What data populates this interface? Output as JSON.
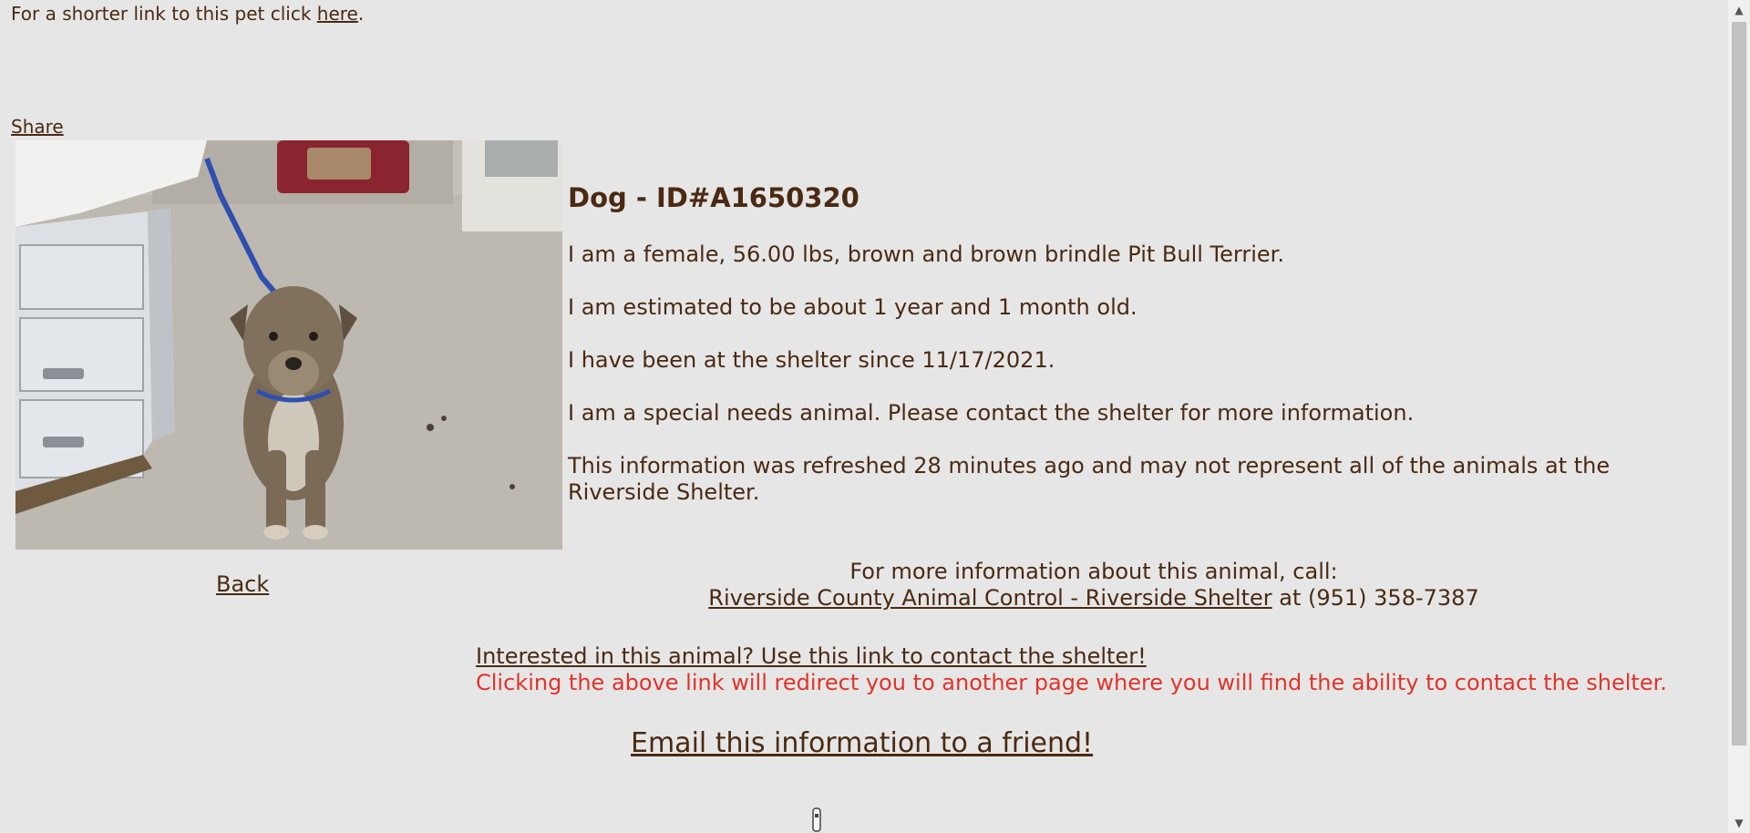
{
  "shortlink": {
    "prefix": "For a shorter link to this pet click ",
    "link_label": "here",
    "suffix": "."
  },
  "share_label": "Share",
  "animal": {
    "heading": "Dog - ID#A1650320",
    "description": "I am a female, 56.00 lbs, brown and brown brindle Pit Bull Terrier.",
    "age": "I am estimated to be about 1 year and 1 month old.",
    "since": "I have been at the shelter since 11/17/2021.",
    "special_needs": "I am a special needs animal. Please contact the shelter for more information.",
    "refreshed": "This information was refreshed 28 minutes ago and may not represent all of the animals at the Riverside Shelter."
  },
  "back_label": "Back",
  "contact": {
    "line1": "For more information about this animal, call:",
    "shelter_link": "Riverside County Animal Control - Riverside Shelter",
    "phone_text": " at (951) 358-7387"
  },
  "interest": {
    "link_label": "Interested in this animal? Use this link to contact the shelter!",
    "warning": "Clicking the above link will redirect you to another page where you will find the ability to contact the shelter."
  },
  "email_label": "Email this information to a friend!",
  "colors": {
    "background": "#e6e6e6",
    "text": "#4a2a12",
    "warning": "#e0342a"
  }
}
